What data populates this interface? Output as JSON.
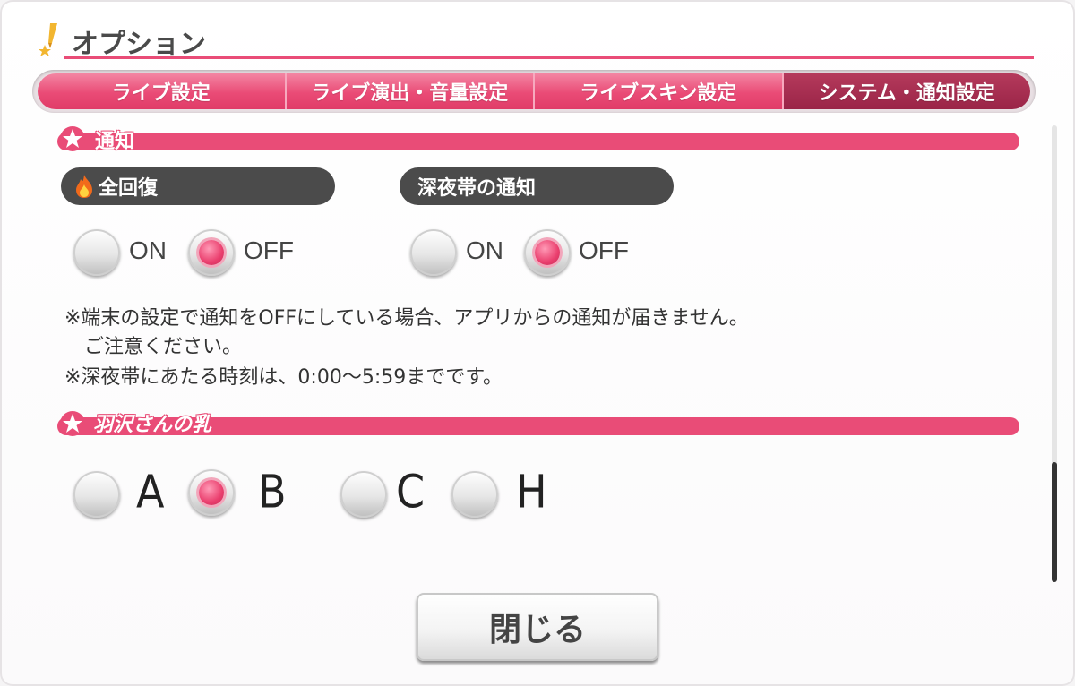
{
  "header": {
    "title": "オプション"
  },
  "tabs": [
    {
      "label": "ライブ設定",
      "active": false
    },
    {
      "label": "ライブ演出・音量設定",
      "active": false
    },
    {
      "label": "ライブスキン設定",
      "active": false
    },
    {
      "label": "システム・通知設定",
      "active": true
    }
  ],
  "section_notify": {
    "title": "通知",
    "full_recovery": {
      "label": "全回復",
      "on_label": "ON",
      "off_label": "OFF",
      "selected": "OFF"
    },
    "late_night": {
      "label": "深夜帯の通知",
      "on_label": "ON",
      "off_label": "OFF",
      "selected": "OFF"
    },
    "notes": [
      "※端末の設定で通知をOFFにしている場合、アプリからの通知が届きません。",
      "　ご注意ください。",
      "※深夜帯にあたる時刻は、0:00〜5:59までです。"
    ]
  },
  "section_custom": {
    "title": "羽沢さんの乳",
    "options": [
      "A",
      "B",
      "C",
      "H"
    ],
    "selected": "B"
  },
  "close_button": {
    "label": "閉じる"
  },
  "colors": {
    "accent": "#e94c77",
    "active_tab": "#9a2447",
    "pill": "#4b4b4b"
  }
}
